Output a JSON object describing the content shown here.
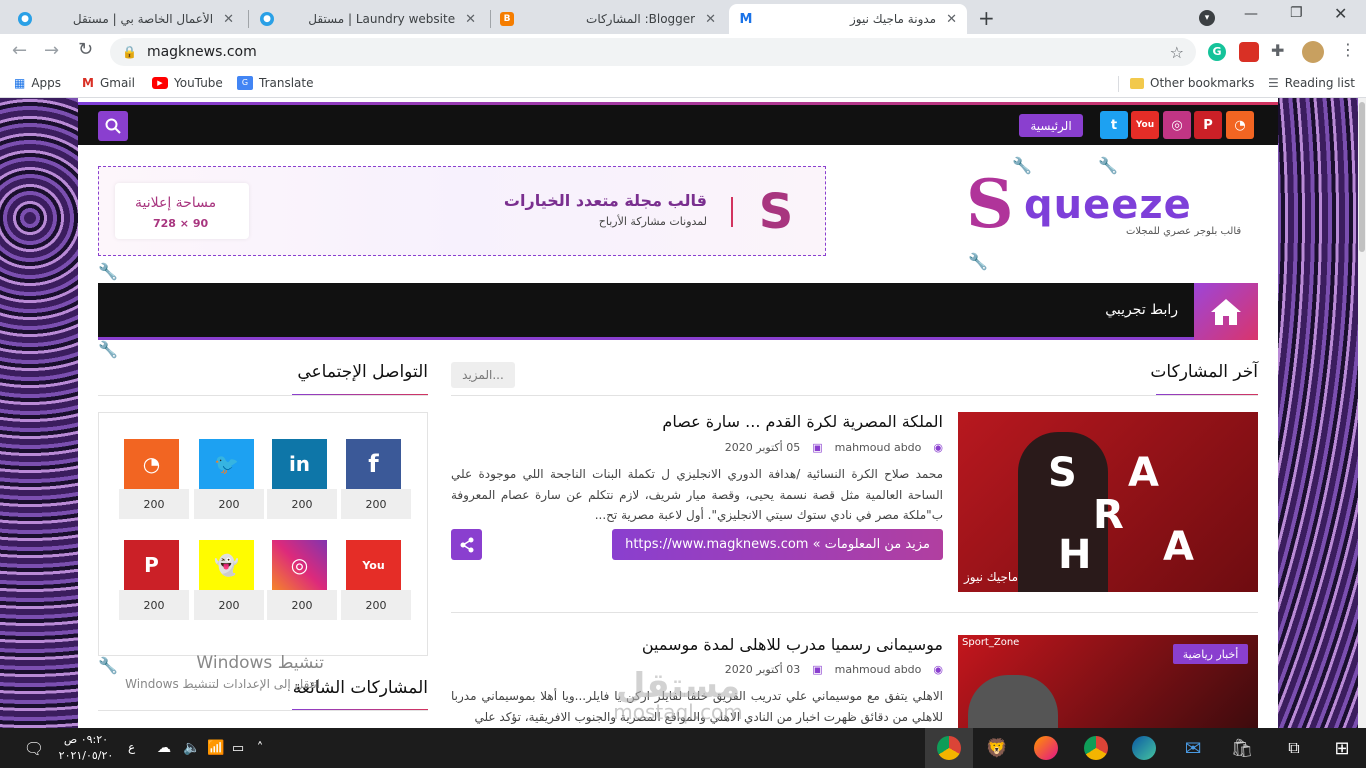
{
  "browser": {
    "tabs": [
      {
        "title": "الأعمال الخاصة بي | مستقل",
        "favicon_color": "#2aa0e6",
        "active": false
      },
      {
        "title": "Laundry website | مستقل",
        "favicon_color": "#2aa0e6",
        "active": false
      },
      {
        "title": "Blogger: المشاركات",
        "favicon_color": "#f57d00",
        "active": false
      },
      {
        "title": "مدونة ماجيك نيوز",
        "favicon_color": "#ffffff",
        "favicon_letter": "M",
        "active": true
      }
    ],
    "new_tab_label": "+",
    "url": "magknews.com",
    "bookmarks": [
      "Apps",
      "Gmail",
      "YouTube",
      "Translate"
    ],
    "other_bookmarks": "Other bookmarks",
    "reading_list": "Reading list"
  },
  "site": {
    "home_label": "الرئيسية",
    "social_icons": [
      "rss-icon",
      "pinterest-icon",
      "instagram-icon",
      "youtube-icon",
      "twitter-icon"
    ],
    "ad": {
      "headline": "قالب مجلة متعدد الخيارات",
      "subline": "لمدونات مشاركة الأرباح",
      "space_label": "مساحة إعلانية",
      "space_size": "728 × 90"
    },
    "logo": {
      "text": "Squeeze",
      "tagline": "قالب بلوجر عصري للمجلات"
    },
    "nav_link": "رابط تجريبي",
    "latest_heading": "آخر المشاركات",
    "more_button": "المزيد...",
    "posts": [
      {
        "title": "الملكة المصرية لكرة القدم ... سارة عصام",
        "author": "mahmoud abdo",
        "date": "05 أكتوبر 2020",
        "excerpt": "محمد صلاح الكرة النسائية /هدافة الدوري الانجليزي ل تكملة البنات الناجحة اللي موجودة علي الساحة العالمية مثل قصة نسمة يحيى، وقصة ميار شريف، لازم نتكلم عن سارة عصام المعروفة ب\"ملكة مصر في نادي ستوك سيتي الانجليزي\". أول لاعبة مصرية تح...",
        "read_more": "مزيد من المعلومات » https://www.magknews.com",
        "thumb_letters": [
          "S",
          "A",
          "R",
          "H",
          "A"
        ],
        "thumb_caption": "ماجيك نيوز"
      },
      {
        "title": "موسيمانى رسميا مدرب للاهلى لمدة موسمين",
        "author": "mahmoud abdo",
        "date": "03 أكتوبر 2020",
        "excerpt": "الاهلي يتفق مع موسيماني علي تدريب الفريق خلفا لفايلر اركن يا فايلر...ويا أهلا بموسيماني مدربا للاهلي من دقائق ظهرت اخبار من النادي الاهلي والمواقع المصرية والجنوب الافريقية، تؤكد علي",
        "badge": "أخبار رياضية",
        "thumb_caption": "Sport_Zone"
      }
    ],
    "social_heading": "التواصل الإجتماعي",
    "social_counters": [
      {
        "icon": "facebook-icon",
        "glyph": "f",
        "color": "#3b5998",
        "count": "200"
      },
      {
        "icon": "linkedin-icon",
        "glyph": "in",
        "color": "#0e76a8",
        "count": "200"
      },
      {
        "icon": "twitter-icon",
        "glyph": "t",
        "color": "#1da1f2",
        "count": "200"
      },
      {
        "icon": "rss-icon",
        "glyph": "rss",
        "color": "#f26522",
        "count": "200"
      },
      {
        "icon": "youtube-icon",
        "glyph": "You",
        "color": "#e52d27",
        "count": "200"
      },
      {
        "icon": "instagram-icon",
        "glyph": "ig",
        "color": "#c13584",
        "count": "200"
      },
      {
        "icon": "snapchat-icon",
        "glyph": "sc",
        "color": "#fffc00",
        "count": "200"
      },
      {
        "icon": "pinterest-icon",
        "glyph": "p",
        "color": "#cb2027",
        "count": "200"
      }
    ],
    "popular_heading": "المشاركات الشائعة"
  },
  "overlay": {
    "activate_title": "تنشيط Windows",
    "activate_sub": "انتقل إلى الإعدادات لتنشيط Windows",
    "watermark_ar": "مستقل",
    "watermark_en": "mostaql.com"
  },
  "taskbar": {
    "time": "٠٩:٢٠ ص",
    "date": "٢٠٢١/٠٥/٢٠",
    "lang": "ع"
  }
}
